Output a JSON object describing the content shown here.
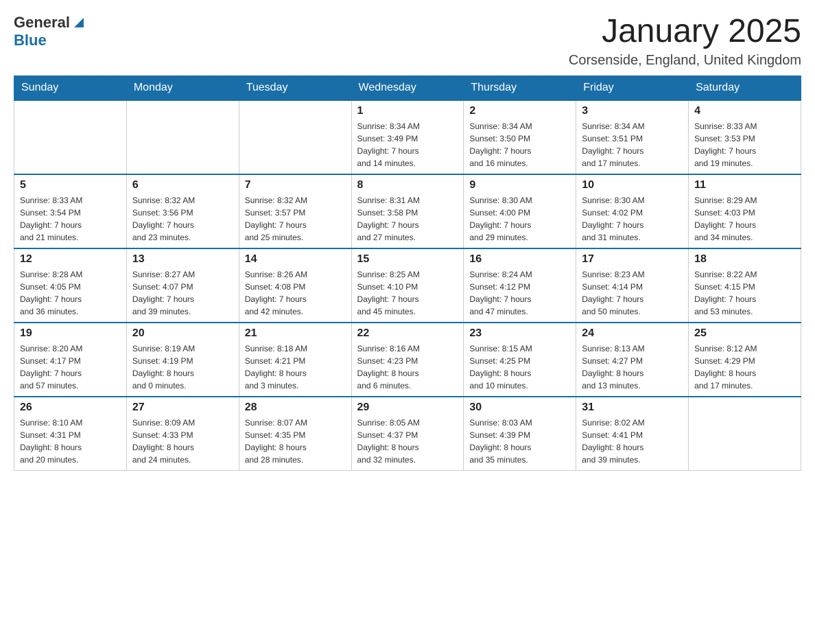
{
  "header": {
    "logo_general": "General",
    "logo_blue": "Blue",
    "month_title": "January 2025",
    "location": "Corsenside, England, United Kingdom"
  },
  "weekdays": [
    "Sunday",
    "Monday",
    "Tuesday",
    "Wednesday",
    "Thursday",
    "Friday",
    "Saturday"
  ],
  "weeks": [
    [
      {
        "day": "",
        "info": ""
      },
      {
        "day": "",
        "info": ""
      },
      {
        "day": "",
        "info": ""
      },
      {
        "day": "1",
        "info": "Sunrise: 8:34 AM\nSunset: 3:49 PM\nDaylight: 7 hours\nand 14 minutes."
      },
      {
        "day": "2",
        "info": "Sunrise: 8:34 AM\nSunset: 3:50 PM\nDaylight: 7 hours\nand 16 minutes."
      },
      {
        "day": "3",
        "info": "Sunrise: 8:34 AM\nSunset: 3:51 PM\nDaylight: 7 hours\nand 17 minutes."
      },
      {
        "day": "4",
        "info": "Sunrise: 8:33 AM\nSunset: 3:53 PM\nDaylight: 7 hours\nand 19 minutes."
      }
    ],
    [
      {
        "day": "5",
        "info": "Sunrise: 8:33 AM\nSunset: 3:54 PM\nDaylight: 7 hours\nand 21 minutes."
      },
      {
        "day": "6",
        "info": "Sunrise: 8:32 AM\nSunset: 3:56 PM\nDaylight: 7 hours\nand 23 minutes."
      },
      {
        "day": "7",
        "info": "Sunrise: 8:32 AM\nSunset: 3:57 PM\nDaylight: 7 hours\nand 25 minutes."
      },
      {
        "day": "8",
        "info": "Sunrise: 8:31 AM\nSunset: 3:58 PM\nDaylight: 7 hours\nand 27 minutes."
      },
      {
        "day": "9",
        "info": "Sunrise: 8:30 AM\nSunset: 4:00 PM\nDaylight: 7 hours\nand 29 minutes."
      },
      {
        "day": "10",
        "info": "Sunrise: 8:30 AM\nSunset: 4:02 PM\nDaylight: 7 hours\nand 31 minutes."
      },
      {
        "day": "11",
        "info": "Sunrise: 8:29 AM\nSunset: 4:03 PM\nDaylight: 7 hours\nand 34 minutes."
      }
    ],
    [
      {
        "day": "12",
        "info": "Sunrise: 8:28 AM\nSunset: 4:05 PM\nDaylight: 7 hours\nand 36 minutes."
      },
      {
        "day": "13",
        "info": "Sunrise: 8:27 AM\nSunset: 4:07 PM\nDaylight: 7 hours\nand 39 minutes."
      },
      {
        "day": "14",
        "info": "Sunrise: 8:26 AM\nSunset: 4:08 PM\nDaylight: 7 hours\nand 42 minutes."
      },
      {
        "day": "15",
        "info": "Sunrise: 8:25 AM\nSunset: 4:10 PM\nDaylight: 7 hours\nand 45 minutes."
      },
      {
        "day": "16",
        "info": "Sunrise: 8:24 AM\nSunset: 4:12 PM\nDaylight: 7 hours\nand 47 minutes."
      },
      {
        "day": "17",
        "info": "Sunrise: 8:23 AM\nSunset: 4:14 PM\nDaylight: 7 hours\nand 50 minutes."
      },
      {
        "day": "18",
        "info": "Sunrise: 8:22 AM\nSunset: 4:15 PM\nDaylight: 7 hours\nand 53 minutes."
      }
    ],
    [
      {
        "day": "19",
        "info": "Sunrise: 8:20 AM\nSunset: 4:17 PM\nDaylight: 7 hours\nand 57 minutes."
      },
      {
        "day": "20",
        "info": "Sunrise: 8:19 AM\nSunset: 4:19 PM\nDaylight: 8 hours\nand 0 minutes."
      },
      {
        "day": "21",
        "info": "Sunrise: 8:18 AM\nSunset: 4:21 PM\nDaylight: 8 hours\nand 3 minutes."
      },
      {
        "day": "22",
        "info": "Sunrise: 8:16 AM\nSunset: 4:23 PM\nDaylight: 8 hours\nand 6 minutes."
      },
      {
        "day": "23",
        "info": "Sunrise: 8:15 AM\nSunset: 4:25 PM\nDaylight: 8 hours\nand 10 minutes."
      },
      {
        "day": "24",
        "info": "Sunrise: 8:13 AM\nSunset: 4:27 PM\nDaylight: 8 hours\nand 13 minutes."
      },
      {
        "day": "25",
        "info": "Sunrise: 8:12 AM\nSunset: 4:29 PM\nDaylight: 8 hours\nand 17 minutes."
      }
    ],
    [
      {
        "day": "26",
        "info": "Sunrise: 8:10 AM\nSunset: 4:31 PM\nDaylight: 8 hours\nand 20 minutes."
      },
      {
        "day": "27",
        "info": "Sunrise: 8:09 AM\nSunset: 4:33 PM\nDaylight: 8 hours\nand 24 minutes."
      },
      {
        "day": "28",
        "info": "Sunrise: 8:07 AM\nSunset: 4:35 PM\nDaylight: 8 hours\nand 28 minutes."
      },
      {
        "day": "29",
        "info": "Sunrise: 8:05 AM\nSunset: 4:37 PM\nDaylight: 8 hours\nand 32 minutes."
      },
      {
        "day": "30",
        "info": "Sunrise: 8:03 AM\nSunset: 4:39 PM\nDaylight: 8 hours\nand 35 minutes."
      },
      {
        "day": "31",
        "info": "Sunrise: 8:02 AM\nSunset: 4:41 PM\nDaylight: 8 hours\nand 39 minutes."
      },
      {
        "day": "",
        "info": ""
      }
    ]
  ]
}
